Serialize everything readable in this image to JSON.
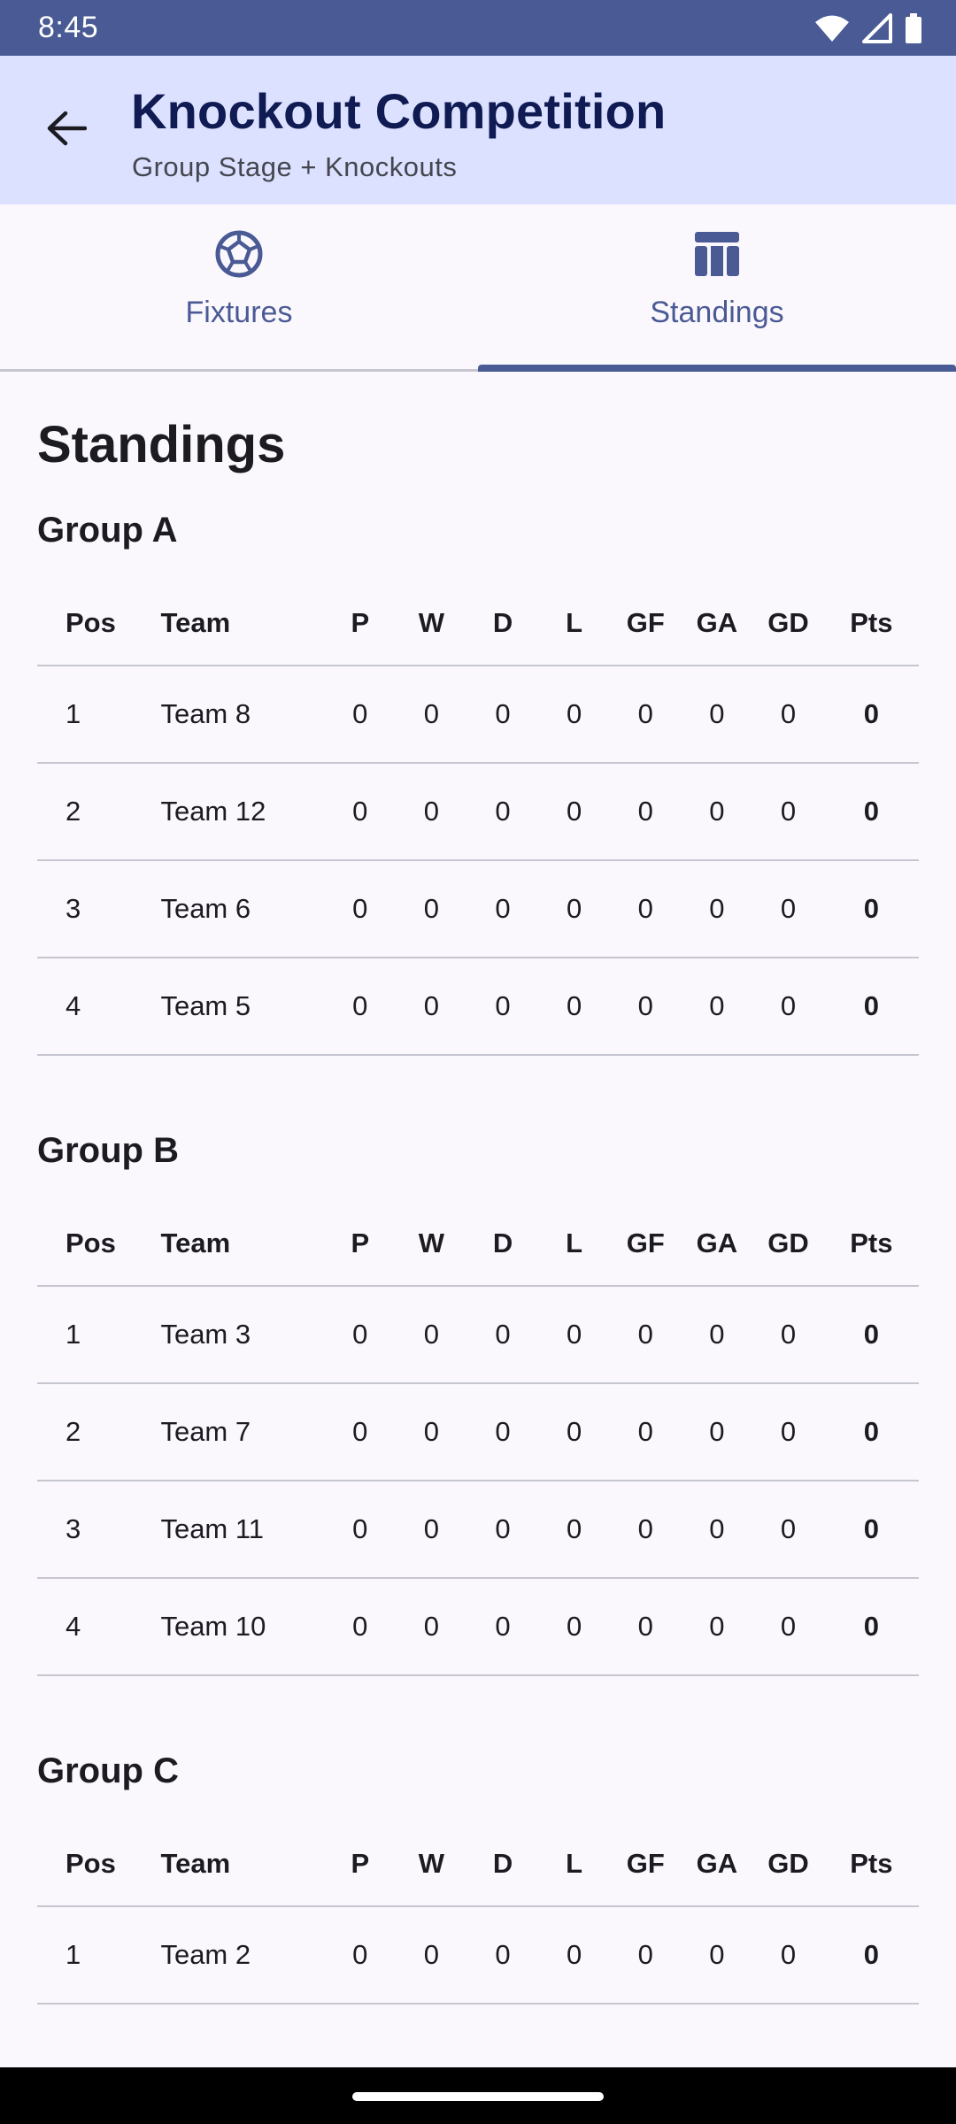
{
  "status_bar": {
    "time": "8:45",
    "icons": [
      "wifi-icon",
      "signal-icon",
      "battery-icon"
    ]
  },
  "app_bar": {
    "title": "Knockout Competition",
    "subtitle": "Group Stage + Knockouts",
    "back_icon": "arrow-back-icon"
  },
  "tabs": [
    {
      "label": "Fixtures",
      "icon": "soccer-ball-icon",
      "selected": false
    },
    {
      "label": "Standings",
      "icon": "table-icon",
      "selected": true
    }
  ],
  "page_heading": "Standings",
  "columns": {
    "pos": "Pos",
    "team": "Team",
    "p": "P",
    "w": "W",
    "d": "D",
    "l": "L",
    "gf": "GF",
    "ga": "GA",
    "gd": "GD",
    "pts": "Pts"
  },
  "groups": [
    {
      "name": "Group A",
      "rows": [
        {
          "pos": "1",
          "team": "Team 8",
          "p": "0",
          "w": "0",
          "d": "0",
          "l": "0",
          "gf": "0",
          "ga": "0",
          "gd": "0",
          "pts": "0"
        },
        {
          "pos": "2",
          "team": "Team 12",
          "p": "0",
          "w": "0",
          "d": "0",
          "l": "0",
          "gf": "0",
          "ga": "0",
          "gd": "0",
          "pts": "0"
        },
        {
          "pos": "3",
          "team": "Team 6",
          "p": "0",
          "w": "0",
          "d": "0",
          "l": "0",
          "gf": "0",
          "ga": "0",
          "gd": "0",
          "pts": "0"
        },
        {
          "pos": "4",
          "team": "Team 5",
          "p": "0",
          "w": "0",
          "d": "0",
          "l": "0",
          "gf": "0",
          "ga": "0",
          "gd": "0",
          "pts": "0"
        }
      ]
    },
    {
      "name": "Group B",
      "rows": [
        {
          "pos": "1",
          "team": "Team 3",
          "p": "0",
          "w": "0",
          "d": "0",
          "l": "0",
          "gf": "0",
          "ga": "0",
          "gd": "0",
          "pts": "0"
        },
        {
          "pos": "2",
          "team": "Team 7",
          "p": "0",
          "w": "0",
          "d": "0",
          "l": "0",
          "gf": "0",
          "ga": "0",
          "gd": "0",
          "pts": "0"
        },
        {
          "pos": "3",
          "team": "Team 11",
          "p": "0",
          "w": "0",
          "d": "0",
          "l": "0",
          "gf": "0",
          "ga": "0",
          "gd": "0",
          "pts": "0"
        },
        {
          "pos": "4",
          "team": "Team 10",
          "p": "0",
          "w": "0",
          "d": "0",
          "l": "0",
          "gf": "0",
          "ga": "0",
          "gd": "0",
          "pts": "0"
        }
      ]
    },
    {
      "name": "Group C",
      "rows": [
        {
          "pos": "1",
          "team": "Team 2",
          "p": "0",
          "w": "0",
          "d": "0",
          "l": "0",
          "gf": "0",
          "ga": "0",
          "gd": "0",
          "pts": "0"
        }
      ]
    }
  ],
  "colors": {
    "primary": "#4a5a94",
    "app_bar_bg": "#dce1ff",
    "title": "#0f1b52",
    "background": "#fbf8fd"
  }
}
